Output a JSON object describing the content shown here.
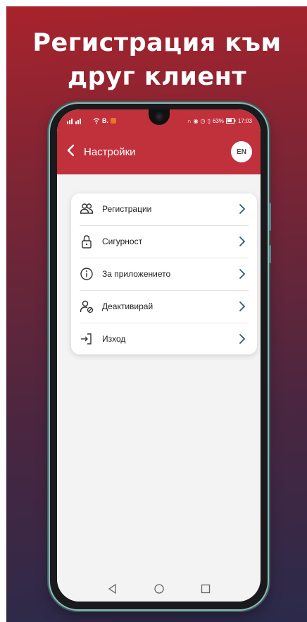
{
  "headline": {
    "line1": "Регистрация към",
    "line2": "друг клиент"
  },
  "status_bar": {
    "carrier": "B.",
    "battery": "63%",
    "time": "17:03"
  },
  "app_bar": {
    "title": "Настройки",
    "language_button": "EN"
  },
  "settings_menu": {
    "items": [
      {
        "label": "Регистрации",
        "icon": "users-icon"
      },
      {
        "label": "Сигурност",
        "icon": "lock-icon"
      },
      {
        "label": "За приложението",
        "icon": "info-icon"
      },
      {
        "label": "Деактивирай",
        "icon": "user-block-icon"
      },
      {
        "label": "Изход",
        "icon": "logout-icon"
      }
    ]
  },
  "colors": {
    "accent": "#c0313b",
    "chevron": "#2d5f7a",
    "poster_top": "#a8232c",
    "poster_bottom": "#2b2a4a"
  }
}
